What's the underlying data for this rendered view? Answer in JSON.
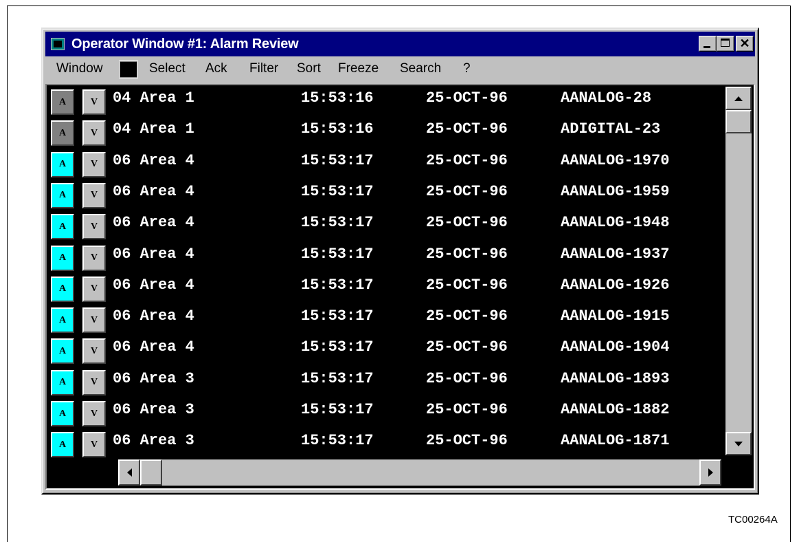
{
  "window": {
    "title": "Operator Window #1: Alarm Review"
  },
  "menu": {
    "items": [
      "Window",
      "Select",
      "Ack",
      "Filter",
      "Sort",
      "Freeze",
      "Search",
      "?"
    ]
  },
  "alarm_list": {
    "ack_button_label": "A",
    "view_button_label": "V",
    "rows": [
      {
        "area": "04 Area 1",
        "time": "15:53:16",
        "date": "25-OCT-96",
        "tag": "AANALOG-28",
        "ack_color": "gray"
      },
      {
        "area": "04 Area 1",
        "time": "15:53:16",
        "date": "25-OCT-96",
        "tag": "ADIGITAL-23",
        "ack_color": "gray"
      },
      {
        "area": "06 Area 4",
        "time": "15:53:17",
        "date": "25-OCT-96",
        "tag": "AANALOG-1970",
        "ack_color": "cyan"
      },
      {
        "area": "06 Area 4",
        "time": "15:53:17",
        "date": "25-OCT-96",
        "tag": "AANALOG-1959",
        "ack_color": "cyan"
      },
      {
        "area": "06 Area 4",
        "time": "15:53:17",
        "date": "25-OCT-96",
        "tag": "AANALOG-1948",
        "ack_color": "cyan"
      },
      {
        "area": "06 Area 4",
        "time": "15:53:17",
        "date": "25-OCT-96",
        "tag": "AANALOG-1937",
        "ack_color": "cyan"
      },
      {
        "area": "06 Area 4",
        "time": "15:53:17",
        "date": "25-OCT-96",
        "tag": "AANALOG-1926",
        "ack_color": "cyan"
      },
      {
        "area": "06 Area 4",
        "time": "15:53:17",
        "date": "25-OCT-96",
        "tag": "AANALOG-1915",
        "ack_color": "cyan"
      },
      {
        "area": "06 Area 4",
        "time": "15:53:17",
        "date": "25-OCT-96",
        "tag": "AANALOG-1904",
        "ack_color": "cyan"
      },
      {
        "area": "06 Area 3",
        "time": "15:53:17",
        "date": "25-OCT-96",
        "tag": "AANALOG-1893",
        "ack_color": "cyan"
      },
      {
        "area": "06 Area 3",
        "time": "15:53:17",
        "date": "25-OCT-96",
        "tag": "AANALOG-1882",
        "ack_color": "cyan"
      },
      {
        "area": "06 Area 3",
        "time": "15:53:17",
        "date": "25-OCT-96",
        "tag": "AANALOG-1871",
        "ack_color": "cyan"
      }
    ]
  },
  "colors": {
    "titlebar": "#000080",
    "list_background": "#000000",
    "ack_unack": "#00ffff",
    "ack_acked": "#808080"
  },
  "icons": [
    "app-icon",
    "minimize-icon",
    "maximize-icon",
    "close-icon",
    "scroll-up-icon",
    "scroll-down-icon",
    "scroll-left-icon",
    "scroll-right-icon"
  ],
  "figure_id": "TC00264A"
}
